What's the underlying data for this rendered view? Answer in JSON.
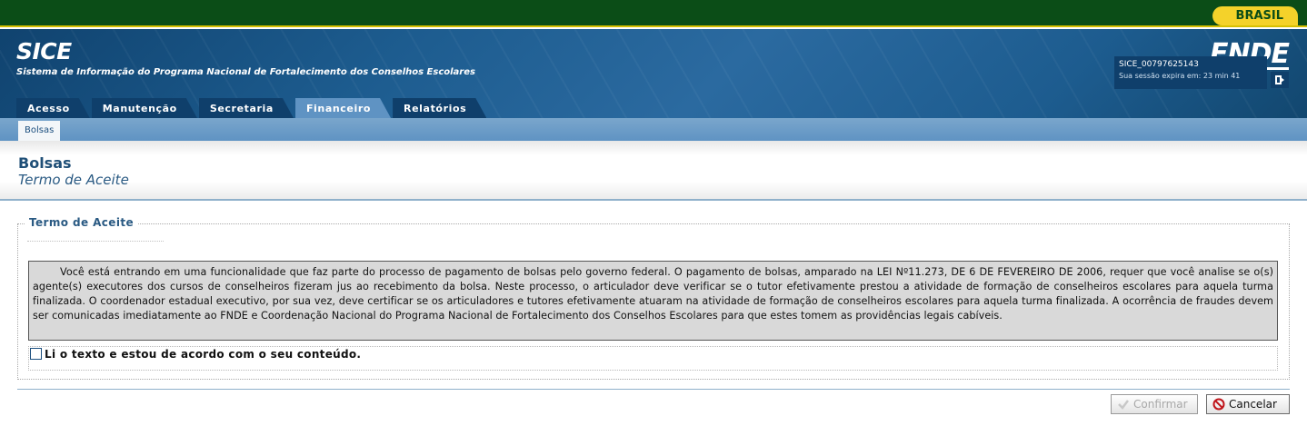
{
  "gov_bar": {
    "badge": "BRASIL"
  },
  "header": {
    "app_title": "SICE",
    "app_subtitle": "Sistema de Informação do Programa Nacional de Fortalecimento dos Conselhos Escolares",
    "logo": "FNDE"
  },
  "tabs": [
    {
      "label": "Acesso",
      "active": false
    },
    {
      "label": "Manutenção",
      "active": false
    },
    {
      "label": "Secretaria",
      "active": false
    },
    {
      "label": "Financeiro",
      "active": true
    },
    {
      "label": "Relatórios",
      "active": false
    }
  ],
  "session": {
    "user": "SICE_00797625143",
    "expire": "Sua sessão expira em: 23 min 41",
    "logout_icon": "logout-icon"
  },
  "subnav": {
    "items": [
      "Bolsas"
    ]
  },
  "page": {
    "title": "Bolsas",
    "subtitle": "Termo de Aceite"
  },
  "fieldset": {
    "legend": "Termo de Aceite",
    "terms": "Você está entrando em uma funcionalidade que faz parte do processo de pagamento de bolsas pelo governo federal. O pagamento de bolsas, amparado na LEI Nº11.273, DE 6 DE FEVEREIRO DE 2006, requer que você analise se o(s) agente(s) executores dos cursos de conselheiros fizeram jus ao recebimento da bolsa. Neste processo, o articulador deve verificar se o tutor efetivamente prestou a atividade de formação de conselheiros escolares para aquela turma finalizada. O coordenador estadual executivo, por sua vez, deve certificar se os articuladores e tutores efetivamente atuaram na atividade de formação de conselheiros escolares para aquela turma finalizada. A ocorrência de fraudes devem ser comunicadas imediatamente ao FNDE e Coordenação Nacional do Programa Nacional de Fortalecimento dos Conselhos Escolares para que estes tomem as providências legais cabíveis.",
    "accept_label": "Li o texto e estou de acordo com o seu conteúdo.",
    "accepted": false
  },
  "buttons": {
    "confirm": "Confirmar",
    "cancel": "Cancelar"
  },
  "colors": {
    "gov_green": "#0b4d17",
    "header_blue": "#1d5c8f",
    "tab_dark": "#0f3f6b",
    "tab_active": "#5f93c3",
    "cancel_red": "#c0141a"
  }
}
